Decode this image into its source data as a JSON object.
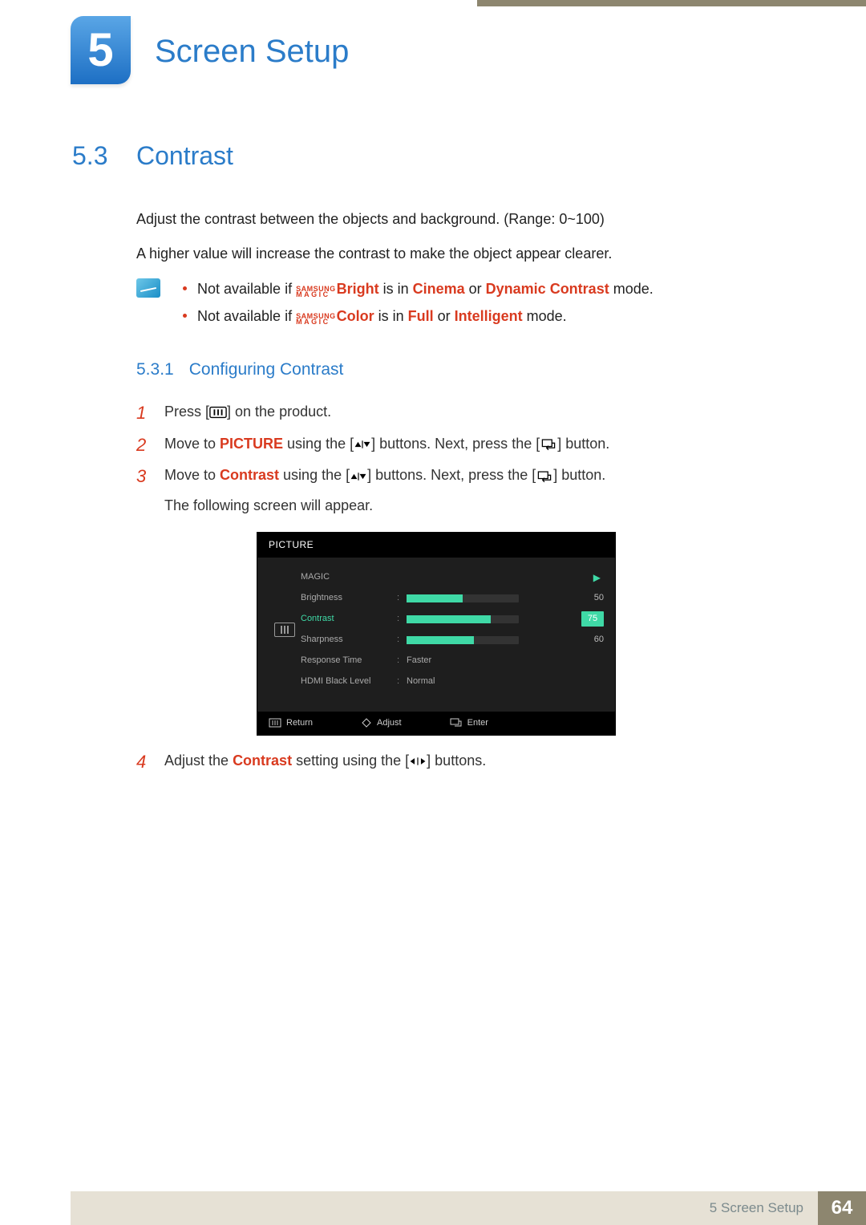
{
  "chapter": {
    "number": "5",
    "title": "Screen Setup"
  },
  "section": {
    "number": "5.3",
    "title": "Contrast"
  },
  "intro": {
    "p1": "Adjust the contrast between the objects and background. (Range: 0~100)",
    "p2": "A higher value will increase the contrast to make the object appear clearer."
  },
  "magic": {
    "top": "SAMSUNG",
    "bottom": "MAGIC"
  },
  "notes": {
    "n1": {
      "pre": "Not available if ",
      "word": "Bright",
      "mid": " is in ",
      "m1": "Cinema",
      "or": " or ",
      "m2": "Dynamic Contrast",
      "post": " mode."
    },
    "n2": {
      "pre": "Not available if ",
      "word": "Color",
      "mid": " is in ",
      "m1": "Full",
      "or": " or ",
      "m2": "Intelligent",
      "post": " mode."
    }
  },
  "subsection": {
    "number": "5.3.1",
    "title": "Configuring Contrast"
  },
  "steps": {
    "s1": {
      "pre": "Press [",
      "post": "] on the product."
    },
    "s2": {
      "pre": "Move to ",
      "kw": "PICTURE",
      "mid": " using the [",
      "mid2": "] buttons. Next, press the [",
      "post": "] button."
    },
    "s3": {
      "pre": "Move to ",
      "kw": "Contrast",
      "mid": " using the [",
      "mid2": "] buttons. Next, press the [",
      "post": "] button.",
      "after": "The following screen will appear."
    },
    "s4": {
      "pre": "Adjust the ",
      "kw": "Contrast",
      "mid": " setting using the [",
      "post": "] buttons."
    }
  },
  "osd": {
    "title": "PICTURE",
    "rows": {
      "magic": "MAGIC",
      "brightness": {
        "label": "Brightness",
        "value": "50",
        "pct": 50
      },
      "contrast": {
        "label": "Contrast",
        "value": "75",
        "pct": 75
      },
      "sharpness": {
        "label": "Sharpness",
        "value": "60",
        "pct": 60
      },
      "response": {
        "label": "Response Time",
        "value": "Faster"
      },
      "hdmi": {
        "label": "HDMI Black Level",
        "value": "Normal"
      }
    },
    "footer": {
      "return": "Return",
      "adjust": "Adjust",
      "enter": "Enter"
    }
  },
  "footer": {
    "text": "5 Screen Setup",
    "page": "64"
  }
}
